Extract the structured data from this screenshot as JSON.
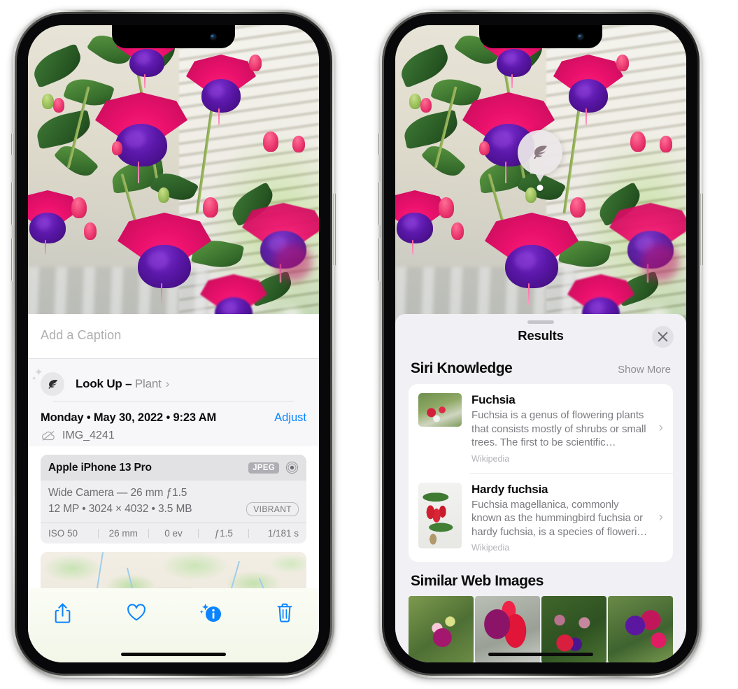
{
  "left_phone": {
    "caption": {
      "placeholder": "Add a Caption",
      "value": ""
    },
    "lookup": {
      "label": "Look Up –",
      "subject": "Plant",
      "chevron": "›",
      "icon": "leaf-icon"
    },
    "datetime": "Monday • May 30, 2022 • 9:23 AM",
    "adjust_label": "Adjust",
    "filename": "IMG_4241",
    "cloud_icon": "icloud-slash-icon",
    "camera_card": {
      "device": "Apple iPhone 13 Pro",
      "format_tag": "JPEG",
      "lens_icon": "aperture-icon",
      "lens_line": "Wide Camera — 26 mm ƒ1.5",
      "specs_line": "12 MP • 3024 × 4032 • 3.5 MB",
      "style_tag": "VIBRANT",
      "exif": [
        "ISO 50",
        "26 mm",
        "0 ev",
        "ƒ1.5",
        "1/181 s"
      ]
    },
    "toolbar": [
      {
        "name": "share-button",
        "icon": "share-icon"
      },
      {
        "name": "favorite-button",
        "icon": "heart-icon"
      },
      {
        "name": "info-button",
        "icon": "info-sparkle-icon"
      },
      {
        "name": "delete-button",
        "icon": "trash-icon"
      }
    ],
    "accent_color": "#0a84ff"
  },
  "right_phone": {
    "visual_lookup_pin": {
      "icon": "leaf-icon"
    },
    "sheet": {
      "title": "Results",
      "close_icon": "close-icon",
      "sections": [
        {
          "title": "Siri Knowledge",
          "action": "Show More",
          "items": [
            {
              "title": "Fuchsia",
              "description": "Fuchsia is a genus of flowering plants that consists mostly of shrubs or small trees. The first to be scientific…",
              "source": "Wikipedia",
              "chevron": "›",
              "thumb": "fuchsia-red-flowers-thumb"
            },
            {
              "title": "Hardy fuchsia",
              "description": "Fuchsia magellanica, commonly known as the hummingbird fuchsia or hardy fuchsia, is a species of floweri…",
              "source": "Wikipedia",
              "chevron": "›",
              "thumb": "hardy-fuchsia-specimen-thumb"
            }
          ]
        },
        {
          "title": "Similar Web Images",
          "images": [
            "fuchsia-pink-white-bloom",
            "fuchsia-red-closeup",
            "fuchsia-shrub-buds",
            "fuchsia-purple-magenta-cluster"
          ]
        }
      ]
    }
  }
}
